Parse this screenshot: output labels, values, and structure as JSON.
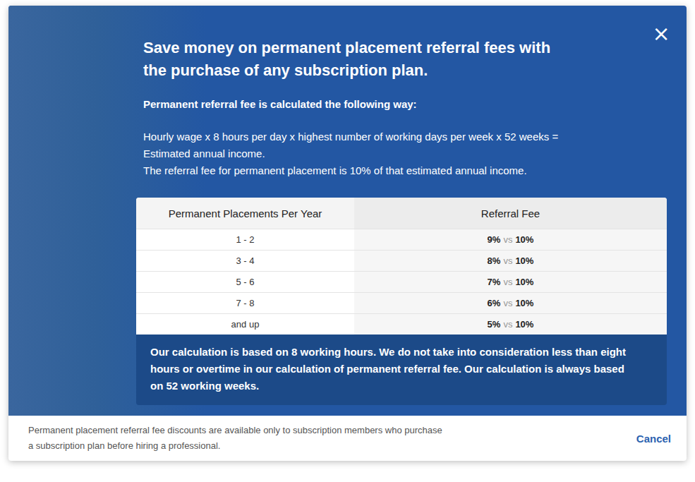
{
  "dialog": {
    "close": "×",
    "title_lines": [
      "Save money on permanent placement referral fees with",
      "the purchase of any subscription plan."
    ],
    "formula": {
      "heading": "Permanent referral fee is calculated the following way:",
      "lines": [
        "Hourly wage x 8 hours per day x highest number of working days per week x 52 weeks =",
        "Estimated annual income.",
        "The referral fee for permanent placement is 10% of that estimated annual income."
      ]
    },
    "table": {
      "columns": [
        "Permanent Placements Per Year",
        "Referral Fee"
      ],
      "rows": [
        {
          "placements": "1 - 2",
          "discounted": "9%",
          "vs": "vs",
          "standard": "10%"
        },
        {
          "placements": "3 - 4",
          "discounted": "8%",
          "vs": "vs",
          "standard": "10%"
        },
        {
          "placements": "5 - 6",
          "discounted": "7%",
          "vs": "vs",
          "standard": "10%"
        },
        {
          "placements": "7 - 8",
          "discounted": "6%",
          "vs": "vs",
          "standard": "10%"
        },
        {
          "placements": "and up",
          "discounted": "5%",
          "vs": "vs",
          "standard": "10%"
        }
      ]
    },
    "note": "Our calculation is based on 8 working hours. We do not take into consideration less than eight hours or overtime in our calculation of permanent referral fee. Our calculation is always based on 52 working weeks.",
    "footer": {
      "lines": [
        "Permanent placement referral fee discounts are available only to subscription members who purchase",
        "a subscription plan before hiring a professional."
      ],
      "cancel": "Cancel"
    }
  }
}
